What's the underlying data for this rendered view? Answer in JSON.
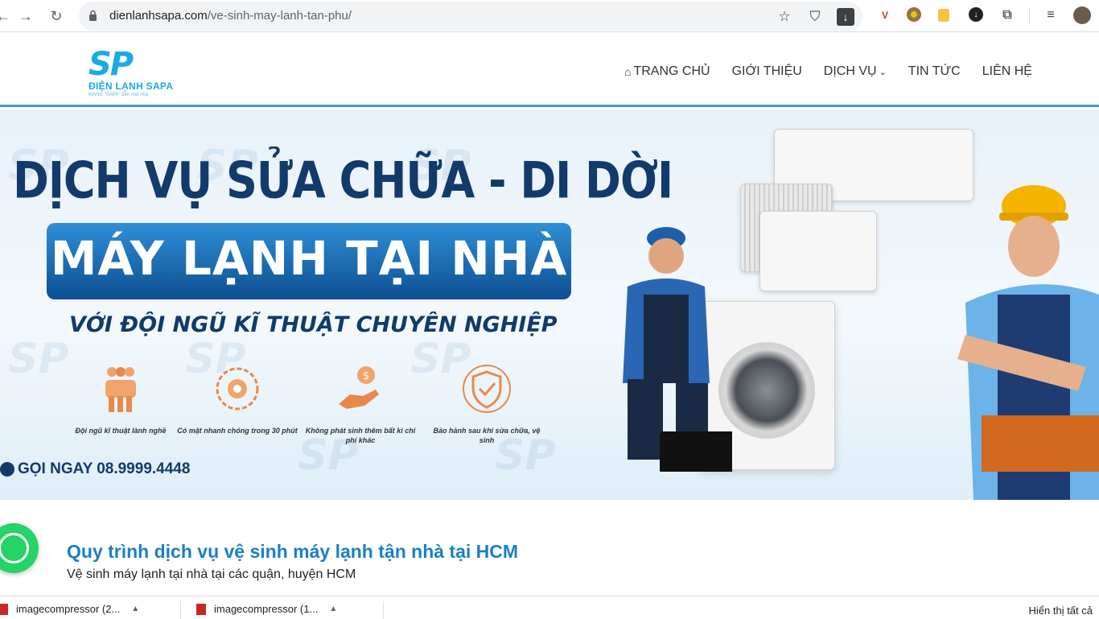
{
  "browser": {
    "url_host": "dienlanhsapa.com",
    "url_path": "/ve-sinh-may-lanh-tan-phu/",
    "icons": [
      "back-icon",
      "forward-icon",
      "reload-icon",
      "lock-icon",
      "star-icon",
      "shield-icon",
      "download-icon",
      "extension-icons",
      "queue-icon",
      "profile-icon"
    ]
  },
  "site": {
    "logo": {
      "mark": "SP",
      "name": "ĐIỆN LẠNH SAPA",
      "slogan": "MANG \"SAPA\" đến mọi nhà"
    },
    "menu": [
      {
        "label": "TRANG CHỦ",
        "icon": "home-icon"
      },
      {
        "label": "GIỚI THIỆU"
      },
      {
        "label": "DỊCH VỤ",
        "icon": "chevron-down-icon"
      },
      {
        "label": "TIN TỨC"
      },
      {
        "label": "LIÊN HỆ"
      }
    ]
  },
  "banner": {
    "headline1": "DỊCH VỤ SỬA CHỮA - DI DỜI",
    "headline2": "MÁY LẠNH TẠI NHÀ",
    "headline3": "VỚI ĐỘI NGŨ KĨ THUẬT CHUYÊN NGHIỆP",
    "features": [
      {
        "label": "Đội ngũ kĩ thuật lành nghề",
        "icon": "team-icon"
      },
      {
        "label": "Có mặt nhanh chóng trong 30 phút",
        "icon": "clock-icon"
      },
      {
        "label": "Không phát sinh thêm bất kì chi phí khác",
        "icon": "hand-coin-icon"
      },
      {
        "label": "Bảo hành sau khi sửa chữa, vệ sinh",
        "icon": "shield-check-icon"
      }
    ],
    "call": "GỌI NGAY 08.9999.4448",
    "accent_color": "#123a6b",
    "box_color": "#1f6fb5"
  },
  "content": {
    "title": "Quy trình dịch vụ vệ sinh máy lạnh tận nhà tại HCM",
    "subtitle": "Vệ sinh máy lạnh tại nhà tại các quận, huyện HCM",
    "title_color": "#1a7fc8"
  },
  "downloads": {
    "items": [
      "imagecompressor (2...",
      "imagecompressor (1..."
    ],
    "show_all": "Hiển thị tất cả"
  }
}
